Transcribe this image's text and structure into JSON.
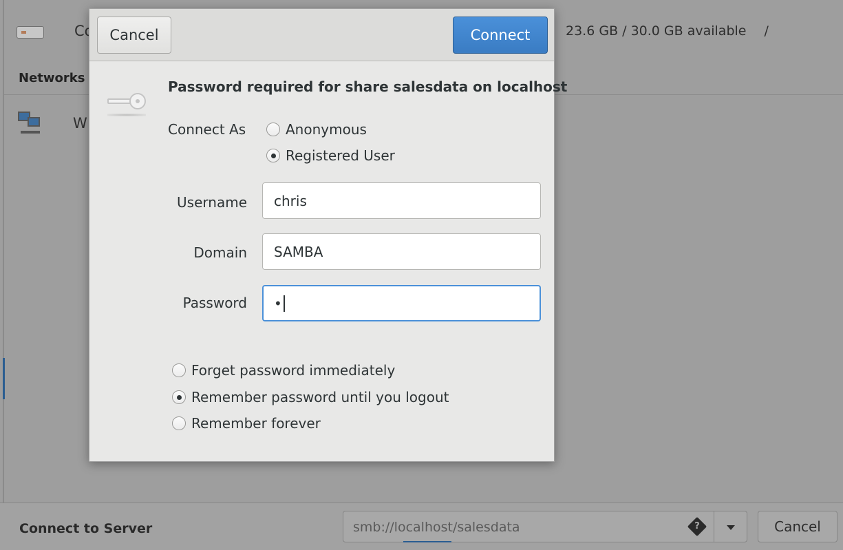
{
  "background": {
    "drive": {
      "label": "Co",
      "info": "23.6 GB / 30.0 GB available",
      "path": "/"
    },
    "section_heading": "Networks",
    "network_item": {
      "label": "W"
    },
    "accent_color": "#2a5d91"
  },
  "bottom_bar": {
    "label": "Connect to Server",
    "server_address": "smb://localhost/salesdata",
    "help_icon": "?",
    "cancel_label": "Cancel"
  },
  "dialog": {
    "cancel_label": "Cancel",
    "connect_label": "Connect",
    "title": "Password required for share salesdata on localhost",
    "connect_as": {
      "label": "Connect As",
      "options": [
        "Anonymous",
        "Registered User"
      ],
      "selected": "Registered User"
    },
    "username": {
      "label": "Username",
      "value": "chris"
    },
    "domain": {
      "label": "Domain",
      "value": "SAMBA"
    },
    "password": {
      "label": "Password",
      "value": "•"
    },
    "remember": {
      "options": [
        "Forget password immediately",
        "Remember password until you logout",
        "Remember forever"
      ],
      "selected": "Remember password until you logout"
    },
    "colors": {
      "accent": "#4a90d9",
      "dialog_bg": "#e8e8e7"
    }
  }
}
